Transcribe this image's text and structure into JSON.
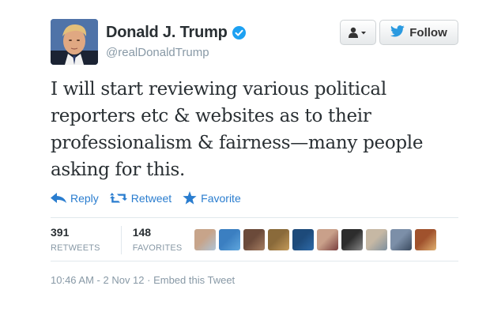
{
  "account": {
    "full_name": "Donald J. Trump",
    "username": "@realDonaldTrump",
    "verified": true
  },
  "buttons": {
    "follow_label": "Follow"
  },
  "tweet": {
    "text": "I will start reviewing various political reporters etc & websites as to their professionalism & fairness—many people asking for this."
  },
  "actions": {
    "reply": "Reply",
    "retweet": "Retweet",
    "favorite": "Favorite"
  },
  "stats": {
    "retweets_count": "391",
    "retweets_label": "RETWEETS",
    "favorites_count": "148",
    "favorites_label": "FAVORITES"
  },
  "favoriter_avatars": [
    {
      "colors": [
        "#c7a48a",
        "#b0c4d6"
      ]
    },
    {
      "colors": [
        "#3b7fc1",
        "#5fa6dd"
      ]
    },
    {
      "colors": [
        "#6b4a3a",
        "#a57e62"
      ]
    },
    {
      "colors": [
        "#8a6a3a",
        "#c49a5a"
      ]
    },
    {
      "colors": [
        "#1d4a7a",
        "#2e6aa8"
      ]
    },
    {
      "colors": [
        "#c9a08a",
        "#7a3f3f"
      ]
    },
    {
      "colors": [
        "#2d2d2d",
        "#888888"
      ]
    },
    {
      "colors": [
        "#c6b8a4",
        "#7d8f9e"
      ]
    },
    {
      "colors": [
        "#7c8fa8",
        "#3a4a5f"
      ]
    },
    {
      "colors": [
        "#a0522d",
        "#e0b070"
      ]
    }
  ],
  "footer": {
    "time": "10:46 AM - 2 Nov 12",
    "separator": " · ",
    "embed": "Embed this Tweet"
  },
  "colors": {
    "link_blue": "#2a7dcf",
    "verified_blue": "#1da1f2",
    "muted_gray": "#8899a6"
  }
}
